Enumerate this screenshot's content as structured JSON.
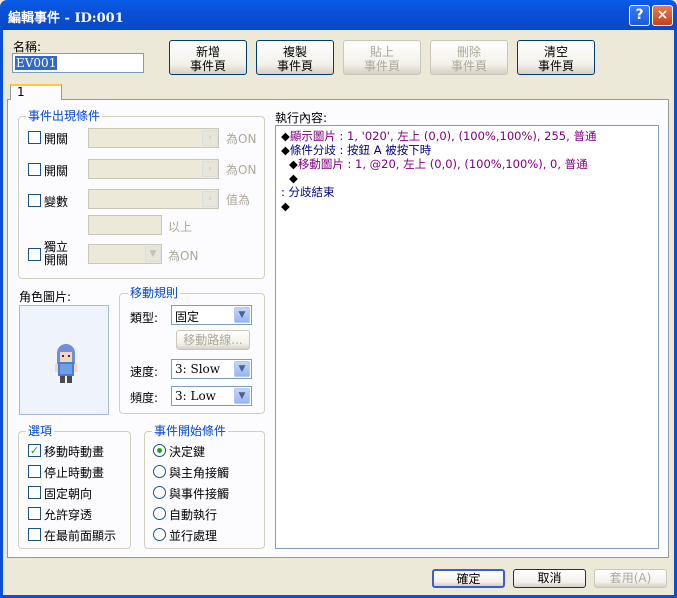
{
  "window": {
    "title": "編輯事件 - ID:001",
    "help_glyph": "?",
    "close_glyph": "×"
  },
  "name": {
    "label": "名稱:",
    "value": "EV001"
  },
  "toolbar": {
    "new_page": "新增\n事件頁",
    "copy_page": "複製\n事件頁",
    "paste_page": "貼上\n事件頁",
    "delete_page": "刪除\n事件頁",
    "clear_page": "清空\n事件頁"
  },
  "tabs": [
    {
      "label": "1"
    }
  ],
  "conditions": {
    "legend": "事件出現條件",
    "switch1": {
      "label": "開關",
      "suffix": "為ON",
      "checked": false
    },
    "switch2": {
      "label": "開關",
      "suffix": "為ON",
      "checked": false
    },
    "variable": {
      "label": "變數",
      "suffix": "值為",
      "above": "以上",
      "checked": false
    },
    "self_switch": {
      "label": "獨立\n開關",
      "suffix": "為ON",
      "checked": false
    }
  },
  "graphic": {
    "label": "角色圖片:"
  },
  "movement": {
    "legend": "移動規則",
    "type_label": "類型:",
    "type_value": "固定",
    "route_button": "移動路線...",
    "speed_label": "速度:",
    "speed_value": "3: Slow",
    "freq_label": "頻度:",
    "freq_value": "3: Low"
  },
  "options": {
    "legend": "選項",
    "items": [
      {
        "label": "移動時動畫",
        "checked": true
      },
      {
        "label": "停止時動畫",
        "checked": false
      },
      {
        "label": "固定朝向",
        "checked": false
      },
      {
        "label": "允許穿透",
        "checked": false
      },
      {
        "label": "在最前面顯示",
        "checked": false
      }
    ]
  },
  "trigger": {
    "legend": "事件開始條件",
    "items": [
      {
        "label": "決定鍵",
        "checked": true
      },
      {
        "label": "與主角接觸",
        "checked": false
      },
      {
        "label": "與事件接觸",
        "checked": false
      },
      {
        "label": "自動執行",
        "checked": false
      },
      {
        "label": "並行處理",
        "checked": false
      }
    ]
  },
  "contents": {
    "label": "執行內容:",
    "lines": [
      {
        "bullet": "◆",
        "text": "顯示圖片 : 1, '020', 左上 (0,0), (100%,100%), 255, 普通",
        "color": "#800080"
      },
      {
        "bullet": "◆",
        "text": "條件分歧 : 按鈕 A 被按下時",
        "color": "#000080"
      },
      {
        "bullet": "◆",
        "text": "移動圖片 : 1, @20, 左上 (0,0), (100%,100%), 0, 普通",
        "color": "#800080"
      },
      {
        "bullet": "◆",
        "text": "",
        "color": "#000000"
      },
      {
        "bullet": "",
        "text": ": 分歧結束",
        "color": "#000080"
      },
      {
        "bullet": "◆",
        "text": "",
        "color": "#000000"
      }
    ]
  },
  "footer": {
    "ok": "確定",
    "cancel": "取消",
    "apply": "套用(A)"
  }
}
